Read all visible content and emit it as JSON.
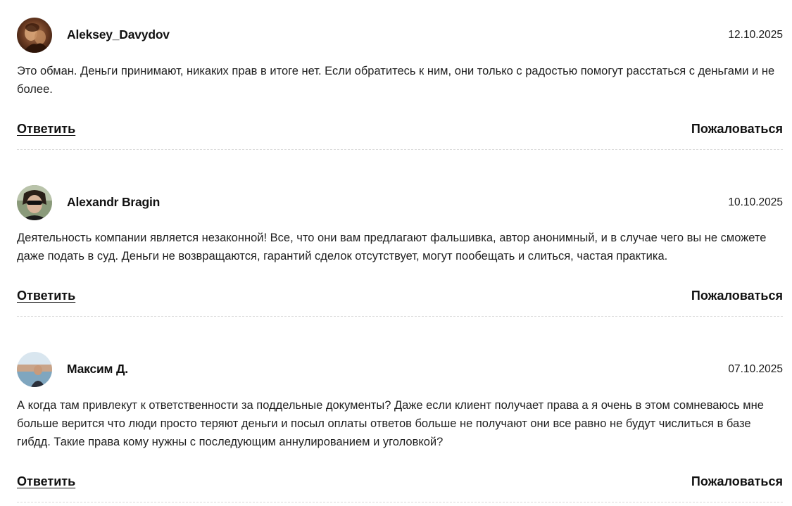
{
  "comments": [
    {
      "author": "Aleksey_Davydov",
      "date": "12.10.2025",
      "text": "Это обман. Деньги принимают, никаких прав в итоге нет. Если обратитесь к ним, они только с радостью помогут расстаться с деньгами и не более.",
      "reply_label": "Ответить",
      "report_label": "Пожаловаться"
    },
    {
      "author": "Alexandr Bragin",
      "date": "10.10.2025",
      "text": "Деятельность компании является незаконной! Все, что они вам предлагают фальшивка, автор анонимный, и в случае чего вы не сможете даже подать в суд. Деньги не возвращаются, гарантий сделок отсутствует, могут пообещать и слиться, частая практика.",
      "reply_label": "Ответить",
      "report_label": "Пожаловаться"
    },
    {
      "author": "Максим Д.",
      "date": "07.10.2025",
      "text": "А когда там привлекут к ответственности за поддельные документы? Даже если клиент получает права а я очень в этом сомневаюсь мне больше верится что люди просто теряют деньги и посыл оплаты ответов больше не получают они все равно не будут числиться в базе гибдд. Такие права кому нужны с последующим аннулированием и уголовкой?",
      "reply_label": "Ответить",
      "report_label": "Пожаловаться"
    }
  ]
}
